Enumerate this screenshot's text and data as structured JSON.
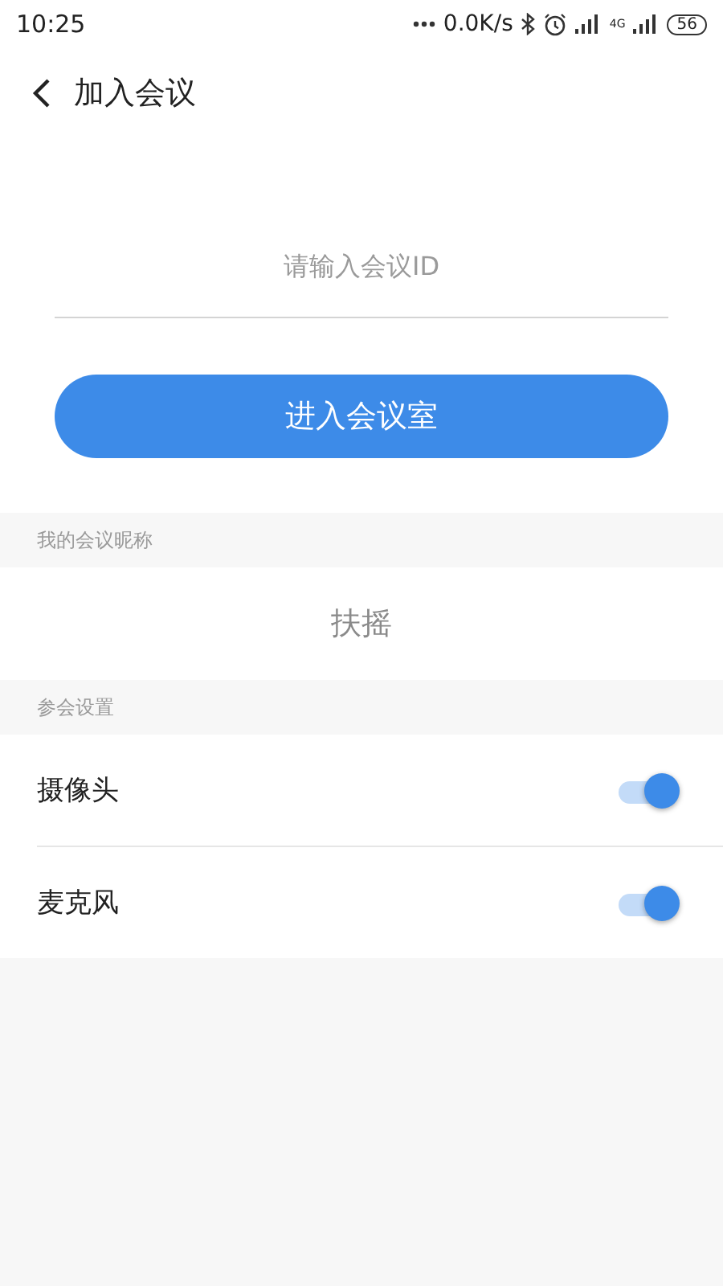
{
  "status_bar": {
    "time": "10:25",
    "network_speed": "0.0K/s",
    "network_type": "4G",
    "battery": "56"
  },
  "header": {
    "title": "加入会议"
  },
  "meeting_id": {
    "placeholder": "请输入会议ID"
  },
  "join_button": {
    "label": "进入会议室"
  },
  "nickname_section": {
    "heading": "我的会议昵称",
    "value": "扶摇"
  },
  "settings_section": {
    "heading": "参会设置",
    "items": [
      {
        "label": "摄像头",
        "on": true
      },
      {
        "label": "麦克风",
        "on": true
      }
    ]
  }
}
